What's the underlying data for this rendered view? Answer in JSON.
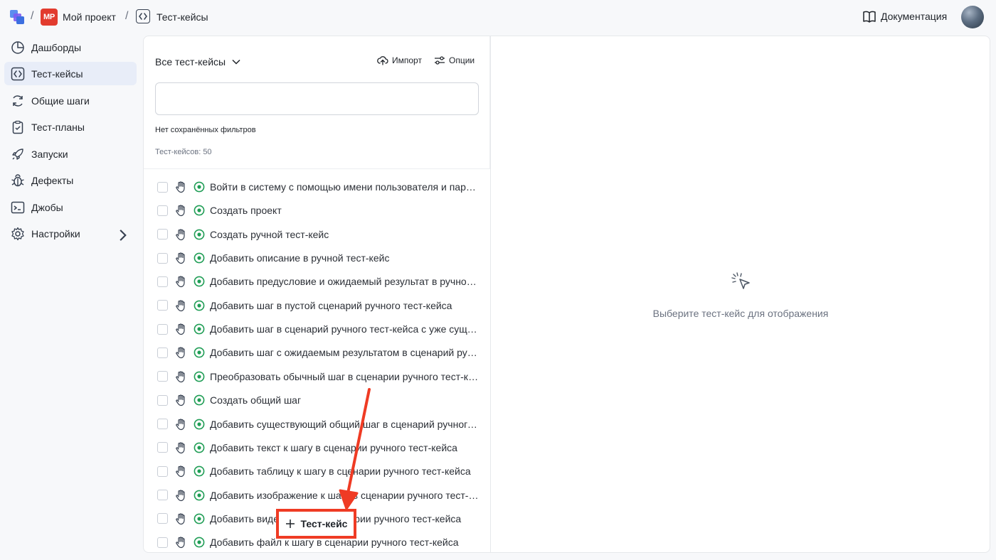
{
  "breadcrumb": {
    "separator": "/",
    "project_badge": "MP",
    "project_name": "Мой проект",
    "section_name": "Тест-кейсы"
  },
  "header": {
    "docs_label": "Документация"
  },
  "sidebar": {
    "items": [
      {
        "label": "Дашборды",
        "icon": "pie-chart-icon"
      },
      {
        "label": "Тест-кейсы",
        "icon": "code-brackets-icon",
        "active": true
      },
      {
        "label": "Общие шаги",
        "icon": "refresh-icon"
      },
      {
        "label": "Тест-планы",
        "icon": "clipboard-check-icon"
      },
      {
        "label": "Запуски",
        "icon": "rocket-icon"
      },
      {
        "label": "Дефекты",
        "icon": "bug-icon"
      },
      {
        "label": "Джобы",
        "icon": "terminal-icon"
      },
      {
        "label": "Настройки",
        "icon": "gear-icon",
        "has_submenu": true
      }
    ]
  },
  "list": {
    "filter_label": "Все тест-кейсы",
    "import_label": "Импорт",
    "options_label": "Опции",
    "search_value": "",
    "no_filters_text": "Нет сохранённых фильтров",
    "count_text": "Тест-кейсов: 50",
    "items": [
      "Войти в систему с помощью имени пользователя и пароля",
      "Создать проект",
      "Создать ручной тест-кейс",
      "Добавить описание в ручной тест-кейс",
      "Добавить предусловие и ожидаемый результат в ручной тест-кейс",
      "Добавить шаг в пустой сценарий ручного тест-кейса",
      "Добавить шаг в сценарий ручного тест-кейса с уже существующими шагами",
      "Добавить шаг с ожидаемым результатом в сценарий ручного тест-кейса",
      "Преобразовать обычный шаг в сценарии ручного тест-кейса в общий",
      "Создать общий шаг",
      "Добавить существующий общий шаг в сценарий ручного тест-кейса",
      "Добавить текст к шагу в сценарии ручного тест-кейса",
      "Добавить таблицу к шагу в сценарии ручного тест-кейса",
      "Добавить изображение к шагу в сценарии ручного тест-кейса",
      "Добавить видео к шагу в сценарии ручного тест-кейса",
      "Добавить файл к шагу в сценарии ручного тест-кейса"
    ]
  },
  "detail": {
    "empty_text": "Выберите тест-кейс для отображения"
  },
  "add_button": {
    "label": "Тест-кейс"
  },
  "colors": {
    "accent_red": "#ef3b24",
    "status_green": "#1f9d55",
    "active_nav_bg": "#e8edf8"
  }
}
